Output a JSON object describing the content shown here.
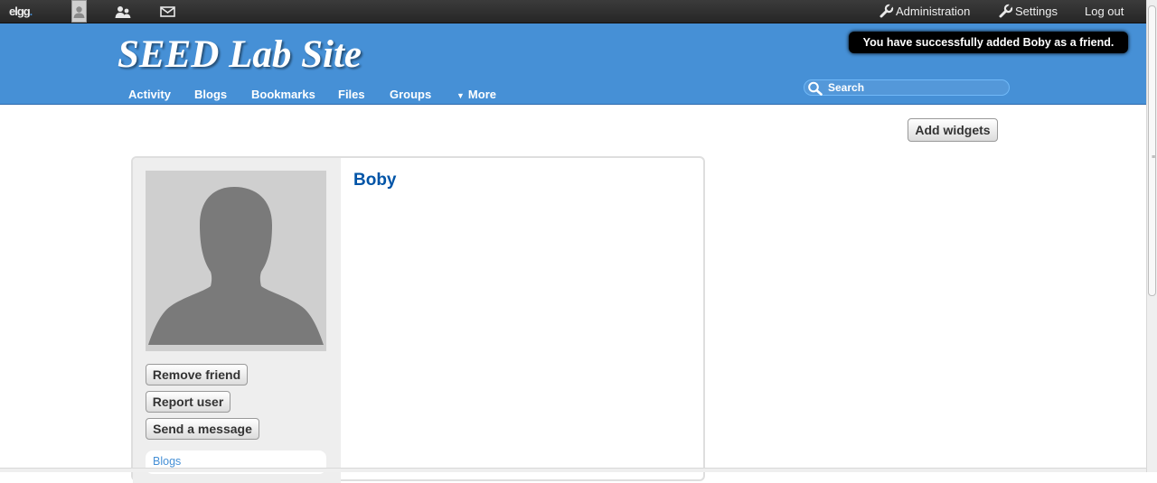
{
  "topbar": {
    "logo": "elgg",
    "logo_dot": ".",
    "admin_label": "Administration",
    "settings_label": "Settings",
    "logout_label": "Log out",
    "icons": [
      "avatar-thumbnail",
      "friends-icon",
      "mail-icon",
      "wrench-icon"
    ]
  },
  "header": {
    "site_title": "SEED Lab Site",
    "nav": [
      "Activity",
      "Blogs",
      "Bookmarks",
      "Files",
      "Groups",
      "More"
    ],
    "search_placeholder": "Search"
  },
  "notice": "You have successfully added Boby as a friend.",
  "widgets": {
    "add_label": "Add widgets"
  },
  "profile": {
    "name": "Boby",
    "actions": [
      "Remove friend",
      "Report user",
      "Send a message"
    ],
    "menu": [
      "Blogs"
    ]
  },
  "colors": {
    "header_blue": "#4690d6",
    "topbar": "#333333",
    "name_link": "#0054a7",
    "sidebar_bg": "#eeeeee"
  }
}
